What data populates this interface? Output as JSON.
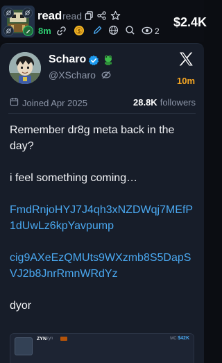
{
  "token": {
    "name": "read",
    "subname": "read",
    "age": "8m",
    "watchers": "2",
    "market_cap": "$2.4K"
  },
  "tweet": {
    "author_name": "Scharo",
    "author_handle": "@XScharo",
    "age": "10m",
    "joined": "Joined Apr 2025",
    "followers_count": "28.8K",
    "followers_label": "followers",
    "lines": [
      "Remember dr8g meta back in the day?",
      "i feel something coming…"
    ],
    "contract_addresses": [
      "FmdRnjoHYJ7J4qh3xNZDWqj7MEfP1dUwLz6kpYavpump",
      "cig9AXeEzQMUts9WXzmb8S5DapSVJ2b8JnrRmnWRdYz"
    ],
    "closing": "dyor"
  },
  "embed": {
    "name": "ZYN",
    "sub": "zyn",
    "mc_label": "MC",
    "mc_value": "$42K"
  },
  "colors": {
    "age_green": "#2ecc71",
    "tweet_age_orange": "#f5a623",
    "link_blue": "#4aa8f0",
    "verified_blue": "#1d9bf0",
    "card_bg": "#171d29"
  },
  "icons": [
    "copy-icon",
    "share-icon",
    "star-icon",
    "link-icon",
    "coin-icon",
    "pen-icon",
    "globe-icon",
    "search-icon",
    "eye-icon",
    "calendar-icon",
    "x-logo-icon",
    "verified-badge-icon",
    "frog-emoji-icon",
    "eye-off-icon"
  ]
}
